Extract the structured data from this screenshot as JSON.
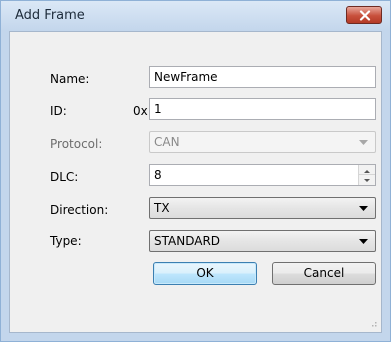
{
  "window": {
    "title": "Add Frame",
    "close_icon": "close-x-icon"
  },
  "form": {
    "name": {
      "label": "Name:",
      "value": "NewFrame"
    },
    "id": {
      "label": "ID:",
      "prefix": "0x",
      "value": "1"
    },
    "protocol": {
      "label": "Protocol:",
      "value": "CAN",
      "enabled": false
    },
    "dlc": {
      "label": "DLC:",
      "value": "8"
    },
    "direction": {
      "label": "Direction:",
      "value": "TX"
    },
    "type": {
      "label": "Type:",
      "value": "STANDARD"
    }
  },
  "buttons": {
    "ok": "OK",
    "cancel": "Cancel"
  },
  "colors": {
    "frame": "#c3d6ec",
    "client": "#f0f0f0",
    "close_button": "#c8503c",
    "default_button_border": "#3c7fb1"
  }
}
